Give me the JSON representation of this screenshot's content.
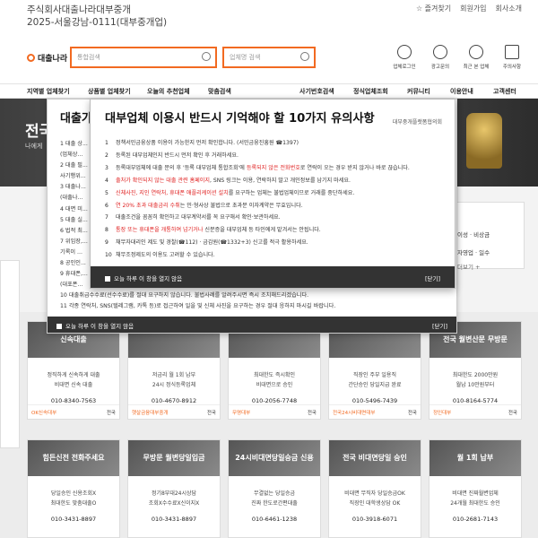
{
  "header": {
    "corp_line1": "주식회사대출나라대부중개",
    "corp_line2": "2025-서울강남-0111(대부중개업)",
    "links": [
      "☆ 즐겨찾기",
      "회원가입",
      "회사소개"
    ],
    "logo": "대출나라",
    "search1_placeholder": "통합검색",
    "search2_placeholder": "업체명 검색",
    "icons": [
      "업체로그인",
      "광고문의",
      "최근 본 업체",
      "주의사항"
    ]
  },
  "nav": {
    "items": [
      "지역별 업체찾기",
      "상품별 업체찾기",
      "오늘의 추천업체",
      "맞춤검색",
      "사기번호검색",
      "정식업체조회",
      "커뮤니티",
      "이용안내",
      "고객센터"
    ]
  },
  "banner": {
    "title": "전국",
    "subtitle": "나에게"
  },
  "popup_back": {
    "title": "대출가",
    "items": [
      "1  대출 상...",
      "(업체상...",
      "2  대출 필...",
      "사기행위...",
      "3  대출나...",
      "(대출나...",
      "4  대면 미...",
      "5  대출 실...",
      "6  법적 최...",
      "7  위임장,...",
      "기록이 ...",
      "8  공인인...",
      "9  휴대폰,...",
      "(대포폰...",
      "10  대출취급수수료(선수수료)를 절대 요구하지 않습니다. 불법사례를 알려주시면 즉시 조치해드리겠습니다.",
      "11  각종 연락처, SNS(텔레그램, 카톡 등)로 접근하여 일을 및 신체 사진을 요구하는 경우 절대 응하지 마시길 바랍니다."
    ],
    "footer_check": "오늘 하루 이 창을 열지 않음",
    "close": "[닫기]"
  },
  "popup_front": {
    "title": "대부업체 이용시 반드시 기억해야 할 10가지 유의사항",
    "org": "대부중개플랫폼협의회",
    "items": [
      {
        "num": "1",
        "text": "정책서민금융상품 이용이 가능한지 먼저 확인합니다. (서민금융진흥원 ☎1397)"
      },
      {
        "num": "2",
        "text": "등록된 대부업체인지 반드시 먼저 확인 후 거래하세요."
      },
      {
        "num": "3",
        "pre": "등록대부업체에 대출 문의 후 '등록 대부업체 통합조회'에 ",
        "red": "등록되지 않은 전화번호",
        "post": "로 연락이 오는 경우 받지 않거나 바로 끊습니다."
      },
      {
        "num": "4",
        "red": "출처가 확인되지 않는 대출 관련 홈페이지",
        "post": ", SNS 링크는 이용, 연락하지 말고 개인정보를 남기지 마세요."
      },
      {
        "num": "5",
        "red": "신체사진, 지인 연락처, 휴대폰 애플리케이션 설치",
        "post": "를 요구하는 업체는 불법업체이므로 거래를 중단하세요."
      },
      {
        "num": "6",
        "red": "연 20% 초과 대출금리 수취",
        "post": "는 민·형사상 불법으로 초과분 이자계약은 무효입니다."
      },
      {
        "num": "7",
        "text": "대출조건을 꼼꼼히 확인하고 대부계약서를 꼭 요구해서 확인·보관하세요."
      },
      {
        "num": "8",
        "red": "통장 또는 휴대폰을 개통하여 넘기거나",
        "post": " 신분증을 대부업체 등 타인에게 맡겨서는 안됩니다."
      },
      {
        "num": "9",
        "text": "채무자대리인 제도 및 경찰(☎112) · 금감원(☎1332+3) 신고를 적극 활용하세요."
      },
      {
        "num": "10",
        "text": "채무조정제도의 이용도 고려할 수 있습니다."
      }
    ],
    "footer_check": "오늘 하루 이 창을 열지 않음",
    "close": "[닫기]"
  },
  "right_card": {
    "text": "이성 · 비상금",
    "text2": "자영업 · 일수",
    "more": "더보기 +"
  },
  "cards": [
    {
      "title": "신속대출",
      "l1": "정직하게 신속하게 대출",
      "l2": "비대면 신속 대출",
      "phone": "010-8340-7563",
      "co": "OK신속대부",
      "region": "전국"
    },
    {
      "title": "",
      "l1": "저금리 월 1회 납부",
      "l2": "24시 정식등록업체",
      "phone": "010-4670-8912",
      "co": "햇살금융대부중개",
      "region": "전국"
    },
    {
      "title": "",
      "l1": "최대한도 즉시확인",
      "l2": "비대면으로 승인",
      "phone": "010-2056-7748",
      "co": "무명대부",
      "region": "전국"
    },
    {
      "title": "",
      "l1": "직장인 주부 일용직",
      "l2": "간단승인 당일지급 완료",
      "phone": "010-5496-7439",
      "co": "전국24시비대면대부",
      "region": "전국"
    },
    {
      "title": "전국 월변산문 무방문",
      "l1": "최대한도 2000만원",
      "l2": "월납 10만원부터",
      "phone": "010-8164-5774",
      "co": "정인대부",
      "region": "전국"
    },
    {
      "title": "힘든신전 전화주세요",
      "l1": "당일승인 신용조회X",
      "l2": "최대한도 맞춤대출O",
      "phone": "010-3431-8897",
      "co": "",
      "region": ""
    },
    {
      "title": "무방문 월변당일입금",
      "l1": "정기8부대24시상담",
      "l2": "조회X수수료X신이지X",
      "phone": "010-3431-8897",
      "co": "",
      "region": ""
    },
    {
      "title": "24시비대면당일승금 신용",
      "l1": "무결없는 당일승금",
      "l2": "진짜 한도로간편대출",
      "phone": "010-6461-1238",
      "co": "",
      "region": ""
    },
    {
      "title": "전국 비대면당일 승인",
      "l1": "비대면 무직자 당일승금OK",
      "l2": "직장인 대학생상담 OK",
      "phone": "010-3918-6071",
      "co": "",
      "region": ""
    },
    {
      "title": "월 1회 납부",
      "l1": "비대면 진짜월변업체",
      "l2": "24개월 최대한도 승인",
      "phone": "010-2681-7143",
      "co": "",
      "region": ""
    }
  ]
}
